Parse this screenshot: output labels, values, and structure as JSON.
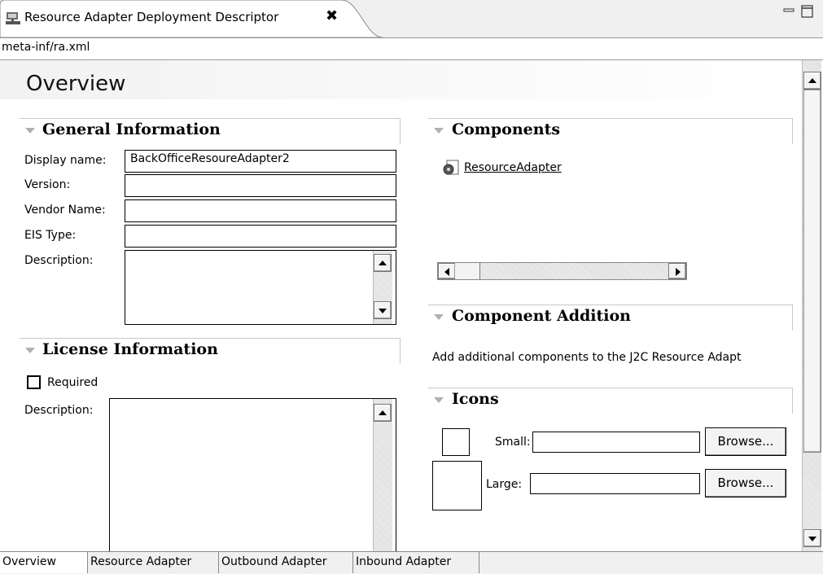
{
  "editor": {
    "tab_title": "Resource Adapter Deployment Descriptor",
    "tab_close": "✖",
    "path": "meta-inf/ra.xml",
    "page_title": "Overview"
  },
  "general": {
    "title": "General Information",
    "display_name_label": "Display name:",
    "display_name_value": "BackOfficeResoureAdapter2",
    "version_label": "Version:",
    "version_value": "",
    "vendor_label": "Vendor Name:",
    "vendor_value": "",
    "eis_label": "EIS Type:",
    "eis_value": "",
    "description_label": "Description:"
  },
  "license": {
    "title": "License Information",
    "required_label": "Required",
    "description_label": "Description:"
  },
  "components": {
    "title": "Components",
    "items": [
      "ResourceAdapter"
    ]
  },
  "component_addition": {
    "title": "Component Addition",
    "text": "Add additional components to the J2C Resource Adapt"
  },
  "icons": {
    "title": "Icons",
    "small_label": "Small:",
    "large_label": "Large:",
    "browse_small": "Browse...",
    "browse_large": "Browse..."
  },
  "bottom_tabs": [
    "Overview",
    "Resource Adapter",
    "Outbound Adapter",
    "Inbound Adapter"
  ]
}
